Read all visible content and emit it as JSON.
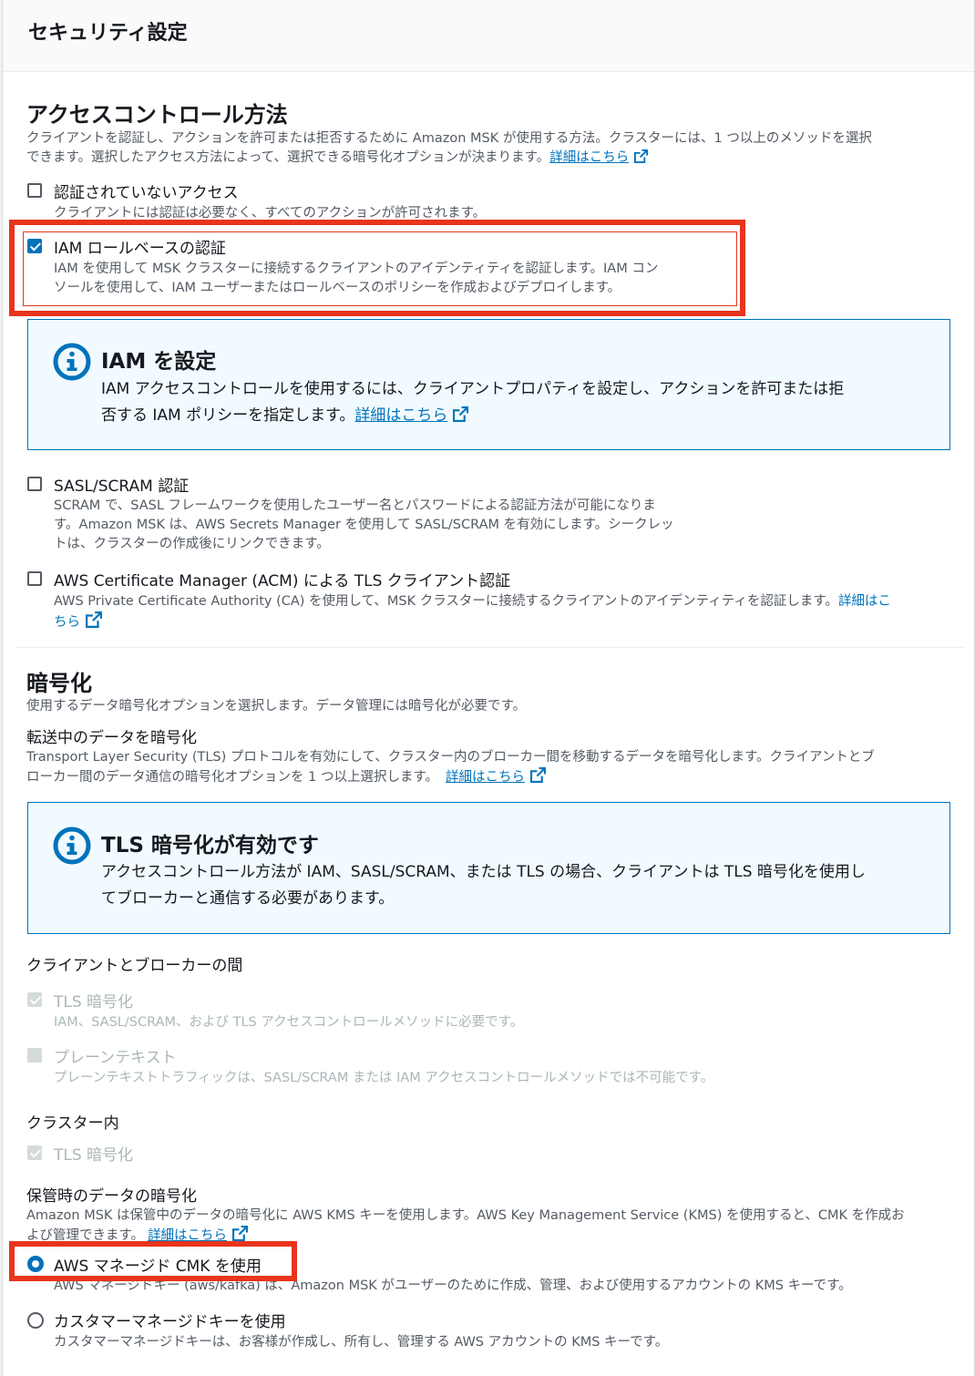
{
  "panel": {
    "title": "セキュリティ設定"
  },
  "access": {
    "heading": "アクセスコントロール方法",
    "desc_line1": "クライアントを認証し、アクションを許可または拒否するために Amazon MSK が使用する方法。クラスターには、1 つ以上のメソッドを選択",
    "desc_line2": "できます。選択したアクセス方法によって、選択できる暗号化オプションが決まります。",
    "learn_more": "詳細はこちら",
    "options": [
      {
        "label": "認証されていないアクセス",
        "desc": [
          "クライアントには認証は必要なく、すべてのアクションが許可されます。"
        ],
        "checked": false
      },
      {
        "label": "IAM ロールベースの認証",
        "desc": [
          "IAM を使用して MSK クラスターに接続するクライアントのアイデンティティを認証します。IAM コン",
          "ソールを使用して、IAM ユーザーまたはロールベースのポリシーを作成およびデプロイします。"
        ],
        "checked": true
      },
      {
        "label": "SASL/SCRAM 認証",
        "desc": [
          "SCRAM で、SASL フレームワークを使用したユーザー名とパスワードによる認証方法が可能になりま",
          "す。Amazon MSK は、AWS Secrets Manager を使用して SASL/SCRAM を有効にします。シークレッ",
          "トは、クラスターの作成後にリンクできます。"
        ],
        "checked": false
      },
      {
        "label": "AWS Certificate Manager (ACM) による TLS クライアント認証",
        "desc": [
          "AWS Private Certificate Authority (CA) を使用して、MSK クラスターに接続するクライアントのアイデンティティを認証します。"
        ],
        "link_a": "詳細はこ",
        "link_b": "ちら",
        "checked": false
      }
    ],
    "iam_info": {
      "title": "IAM を設定",
      "line1": "IAM アクセスコントロールを使用するには、クライアントプロパティを設定し、アクションを許可または拒",
      "line2": "否する IAM ポリシーを指定します。",
      "link": "詳細はこちら"
    }
  },
  "encryption": {
    "heading": "暗号化",
    "desc": "使用するデータ暗号化オプションを選択します。データ管理には暗号化が必要です。",
    "transit": {
      "title": "転送中のデータを暗号化",
      "line1": "Transport Layer Security (TLS) プロトコルを有効にして、クラスター内のブローカー間を移動するデータを暗号化します。クライアントとブ",
      "line2": "ローカー間のデータ通信の暗号化オプションを 1 つ以上選択します。",
      "link": "詳細はこちら"
    },
    "tls_info": {
      "title": "TLS 暗号化が有効です",
      "line1": "アクセスコントロール方法が IAM、SASL/SCRAM、または TLS の場合、クライアントは TLS 暗号化を使用し",
      "line2": "てブローカーと通信する必要があります。"
    },
    "client_broker": {
      "title": "クライアントとブローカーの間",
      "tls_label": "TLS 暗号化",
      "tls_desc": "IAM、SASL/SCRAM、および TLS アクセスコントロールメソッドに必要です。",
      "plain_label": "プレーンテキスト",
      "plain_desc": "プレーンテキストトラフィックは、SASL/SCRAM または IAM アクセスコントロールメソッドでは不可能です。"
    },
    "in_cluster": {
      "title": "クラスター内",
      "tls_label": "TLS 暗号化"
    },
    "at_rest": {
      "title": "保管時のデータの暗号化",
      "line1": "Amazon MSK は保管中のデータの暗号化に AWS KMS キーを使用します。AWS Key Management Service (KMS) を使用すると、CMK を作成お",
      "line2": "よび管理できます。",
      "link": "詳細はこちら",
      "options": [
        {
          "label": "AWS マネージド CMK を使用",
          "desc": "AWS マネージドキー (aws/kafka) は、Amazon MSK がユーザーのために作成、管理、および使用するアカウントの KMS キーです。",
          "selected": true
        },
        {
          "label": "カスタマーマネージドキーを使用",
          "desc": "カスタマーマネージドキーは、お客様が作成し、所有し、管理する AWS アカウントの KMS キーです。",
          "selected": false
        }
      ]
    }
  },
  "colors": {
    "accent": "#0073bb",
    "highlight": "#e8341c",
    "info_bg": "#f1faff"
  }
}
